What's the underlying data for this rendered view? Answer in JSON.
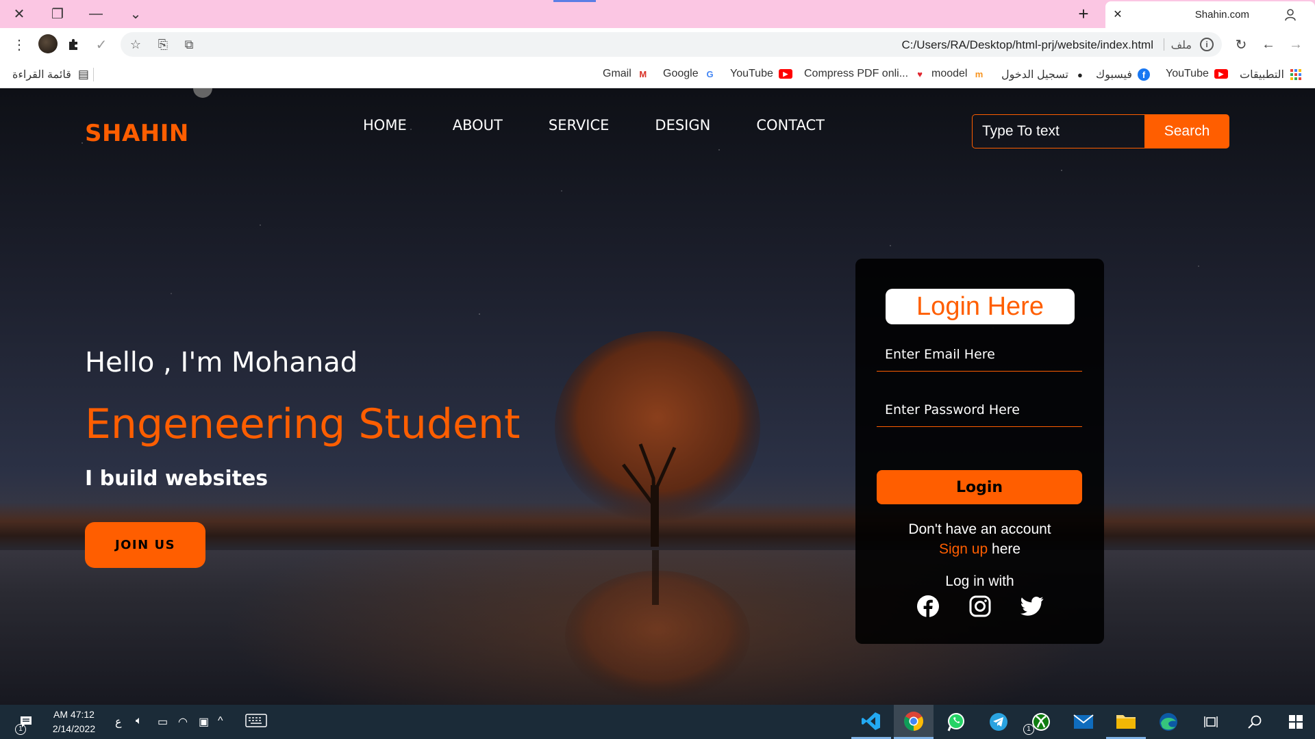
{
  "browser": {
    "tab_title": "Shahin.com",
    "url": "C:/Users/RA/Desktop/html-prj/website/index.html",
    "url_prefix": "ملف",
    "bookmarks": [
      "Gmail",
      "Google",
      "YouTube",
      "Compress PDF onli...",
      "moodel",
      "تسجيل الدخول",
      "فيسبوك",
      "YouTube",
      "التطبيقات"
    ],
    "reading_list": "قائمة القراءة"
  },
  "site": {
    "logo": "SHAHIN",
    "nav": [
      "HOME",
      "ABOUT",
      "SERVICE",
      "DESIGN",
      "CONTACT"
    ],
    "search_placeholder": "Type To text",
    "search_button": "Search",
    "hero": {
      "greeting": "Hello , I'm Mohanad",
      "role": "Engeneering Student",
      "tagline": "I build websites",
      "cta": "JOIN US"
    },
    "login": {
      "title": "Login Here",
      "email_placeholder": "Enter Email Here",
      "password_placeholder": "Enter Password Here",
      "button": "Login",
      "no_account": "Don't have an account",
      "signup_link": "Sign up",
      "signup_suffix": "here",
      "social_heading": "Log in with",
      "social": [
        "facebook-icon",
        "instagram-icon",
        "twitter-icon"
      ]
    },
    "accent_color": "#ff5e00"
  },
  "taskbar": {
    "time": "AM 47:12",
    "date": "2/14/2022",
    "lang": "ع",
    "notification_count": "1"
  }
}
